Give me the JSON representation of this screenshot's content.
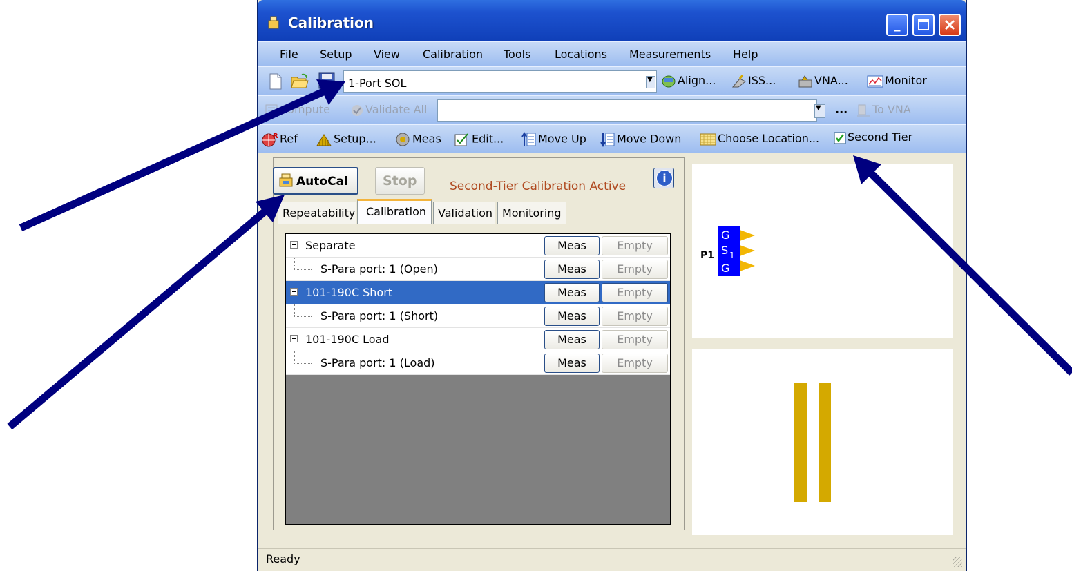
{
  "window": {
    "title": "Calibration"
  },
  "menu": [
    "File",
    "Setup",
    "View",
    "Calibration",
    "Tools",
    "Locations",
    "Measurements",
    "Help"
  ],
  "toolbar1": {
    "cal_type": "1-Port SOL",
    "align": "Align...",
    "iss": "ISS...",
    "vna": "VNA...",
    "monitor": "Monitor"
  },
  "toolbar2": {
    "compute": "Compute",
    "validate_all": "Validate All",
    "ellipsis": "...",
    "to_vna": "To VNA",
    "combo_value": ""
  },
  "toolbar3": {
    "ref": "Ref",
    "setup": "Setup...",
    "meas": "Meas",
    "edit": "Edit...",
    "move_up": "Move Up",
    "move_down": "Move Down",
    "choose_location": "Choose Location...",
    "second_tier": "Second Tier"
  },
  "second_tier_checked": true,
  "panel": {
    "autocal": "AutoCal",
    "stop": "Stop",
    "active_note": "Second-Tier Calibration Active",
    "info": "i"
  },
  "tabs": [
    "Repeatability",
    "Calibration",
    "Validation",
    "Monitoring"
  ],
  "selected_tab": "Calibration",
  "tree_rows": [
    {
      "label": "Separate",
      "level": 0,
      "meas": "Meas",
      "status": "Empty"
    },
    {
      "label": "S-Para port: 1 (Open)",
      "level": 1,
      "meas": "Meas",
      "status": "Empty"
    },
    {
      "label": "101-190C Short",
      "level": 0,
      "meas": "Meas",
      "status": "Empty"
    },
    {
      "label": "S-Para port: 1 (Short)",
      "level": 1,
      "meas": "Meas",
      "status": "Empty"
    },
    {
      "label": "101-190C Load",
      "level": 0,
      "meas": "Meas",
      "status": "Empty"
    },
    {
      "label": "S-Para port: 1 (Load)",
      "level": 1,
      "meas": "Meas",
      "status": "Empty"
    }
  ],
  "selected_row": 2,
  "probe": {
    "port": "P1",
    "pin_top": "G",
    "pin_mid": "S",
    "pin_mid_sub": "1",
    "pin_bot": "G"
  },
  "colors": {
    "probe_blue": "#0000ff",
    "probe_arrow": "#f2b705",
    "standard_gold": "#d4a900",
    "selection": "#316ac5",
    "callout_arrow": "#00007f"
  },
  "status": "Ready"
}
